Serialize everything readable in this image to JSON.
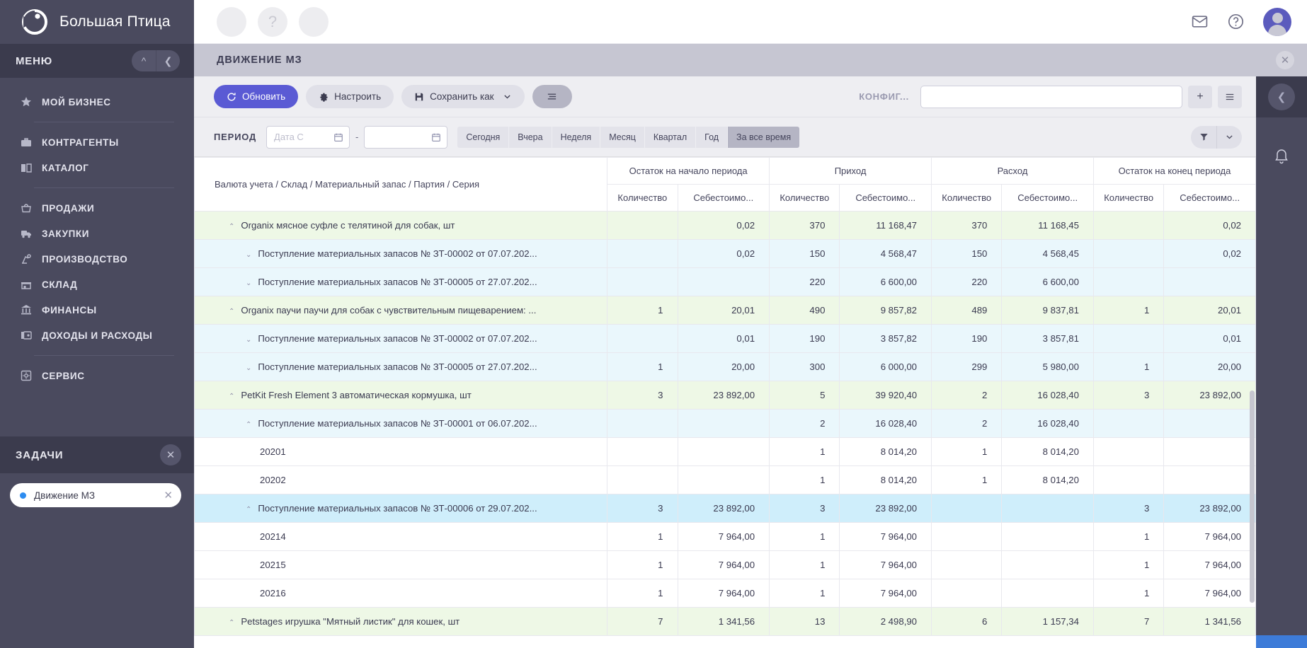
{
  "brand": {
    "name": "Большая Птица",
    "logo_icon": "bird-logo-icon"
  },
  "sidebar": {
    "menu_title": "МЕНЮ",
    "collapse_up_icon": "chevron-up-icon",
    "collapse_left_icon": "chevron-left-icon",
    "items": [
      {
        "label": "МОЙ БИЗНЕС",
        "icon": "star-icon",
        "sep_after": true
      },
      {
        "label": "КОНТРАГЕНТЫ",
        "icon": "briefcase-icon",
        "sep_after": false
      },
      {
        "label": "КАТАЛОГ",
        "icon": "book-icon",
        "sep_after": true
      },
      {
        "label": "ПРОДАЖИ",
        "icon": "basket-icon",
        "sep_after": false
      },
      {
        "label": "ЗАКУПКИ",
        "icon": "truck-icon",
        "sep_after": false
      },
      {
        "label": "ПРОИЗВОДСТВО",
        "icon": "robot-arm-icon",
        "sep_after": false
      },
      {
        "label": "СКЛАД",
        "icon": "warehouse-icon",
        "sep_after": false
      },
      {
        "label": "ФИНАНСЫ",
        "icon": "bank-icon",
        "sep_after": false
      },
      {
        "label": "ДОХОДЫ И РАСХОДЫ",
        "icon": "wallet-icon",
        "sep_after": true
      },
      {
        "label": "СЕРВИС",
        "icon": "service-gear-icon",
        "sep_after": false
      }
    ],
    "tasks": {
      "title": "ЗАДАЧИ",
      "close_icon": "close-icon",
      "items": [
        {
          "label": "Движение МЗ",
          "dot_color": "#2d8cf0",
          "close_icon": "close-icon"
        }
      ]
    }
  },
  "topbar": {
    "circles": [
      {
        "name": "placeholder-circle-1",
        "glyph": ""
      },
      {
        "name": "help-circle",
        "glyph": "?"
      },
      {
        "name": "placeholder-circle-3",
        "glyph": ""
      }
    ],
    "mail_icon": "mail-icon",
    "help_icon": "question-circle-icon",
    "avatar_icon": "user-avatar"
  },
  "page_header": {
    "title": "ДВИЖЕНИЕ МЗ",
    "close_icon": "close-icon"
  },
  "toolbar": {
    "refresh_label": "Обновить",
    "refresh_icon": "refresh-icon",
    "configure_label": "Настроить",
    "configure_icon": "gear-icon",
    "save_as_label": "Сохранить как",
    "save_icon": "floppy-disk-icon",
    "save_caret_icon": "chevron-down-icon",
    "menu_icon": "hamburger-icon",
    "config_label": "КОНФИГ...",
    "config_value": "",
    "config_placeholder": "",
    "add_icon": "plus-icon",
    "list_icon": "list-icon",
    "accent_color": "#5a5ad4"
  },
  "period": {
    "label": "ПЕРИОД",
    "date_from_value": "",
    "date_from_placeholder": "Дата С",
    "date_to_value": "",
    "date_to_placeholder": "",
    "dash": "-",
    "calendar_icon": "calendar-icon",
    "presets": [
      {
        "label": "Сегодня",
        "active": false
      },
      {
        "label": "Вчера",
        "active": false
      },
      {
        "label": "Неделя",
        "active": false
      },
      {
        "label": "Месяц",
        "active": false
      },
      {
        "label": "Квартал",
        "active": false
      },
      {
        "label": "Год",
        "active": false
      },
      {
        "label": "За все время",
        "active": true
      }
    ],
    "filter_icon": "funnel-icon",
    "filter_caret_icon": "chevron-down-icon"
  },
  "table": {
    "name_column_header": "Валюта учета / Склад / Материальный запас / Партия / Серия",
    "groups": [
      {
        "label": "Остаток на начало периода",
        "subs": [
          "Количество",
          "Себестоимо..."
        ]
      },
      {
        "label": "Приход",
        "subs": [
          "Количество",
          "Себестоимо..."
        ]
      },
      {
        "label": "Расход",
        "subs": [
          "Количество",
          "Себестоимо..."
        ]
      },
      {
        "label": "Остаток на конец периода",
        "subs": [
          "Количество",
          "Себестоимо..."
        ]
      }
    ],
    "rows": [
      {
        "level": 0,
        "caret": "up",
        "name": "Organix мясное суфле с телятиной для собак, шт",
        "cells": [
          "",
          "0,02",
          "370",
          "11 168,47",
          "370",
          "11 168,45",
          "",
          "0,02"
        ],
        "selected": false
      },
      {
        "level": 1,
        "caret": "down",
        "name": "Поступление материальных запасов № ЗТ-00002 от 07.07.202...",
        "cells": [
          "",
          "0,02",
          "150",
          "4 568,47",
          "150",
          "4 568,45",
          "",
          "0,02"
        ],
        "selected": false
      },
      {
        "level": 1,
        "caret": "down",
        "name": "Поступление материальных запасов № ЗТ-00005 от 27.07.202...",
        "cells": [
          "",
          "",
          "220",
          "6 600,00",
          "220",
          "6 600,00",
          "",
          ""
        ],
        "selected": false
      },
      {
        "level": 0,
        "caret": "up",
        "name": "Organix паучи паучи для собак с чувствительным пищеварением: ...",
        "cells": [
          "1",
          "20,01",
          "490",
          "9 857,82",
          "489",
          "9 837,81",
          "1",
          "20,01"
        ],
        "selected": false
      },
      {
        "level": 1,
        "caret": "down",
        "name": "Поступление материальных запасов № ЗТ-00002 от 07.07.202...",
        "cells": [
          "",
          "0,01",
          "190",
          "3 857,82",
          "190",
          "3 857,81",
          "",
          "0,01"
        ],
        "selected": false
      },
      {
        "level": 1,
        "caret": "down",
        "name": "Поступление материальных запасов № ЗТ-00005 от 27.07.202...",
        "cells": [
          "1",
          "20,00",
          "300",
          "6 000,00",
          "299",
          "5 980,00",
          "1",
          "20,00"
        ],
        "selected": false
      },
      {
        "level": 0,
        "caret": "up",
        "name": "PetKit Fresh Element 3 автоматическая кормушка, шт",
        "cells": [
          "3",
          "23 892,00",
          "5",
          "39 920,40",
          "2",
          "16 028,40",
          "3",
          "23 892,00"
        ],
        "selected": false
      },
      {
        "level": 1,
        "caret": "up",
        "name": "Поступление материальных запасов № ЗТ-00001 от 06.07.202...",
        "cells": [
          "",
          "",
          "2",
          "16 028,40",
          "2",
          "16 028,40",
          "",
          ""
        ],
        "selected": false
      },
      {
        "level": 2,
        "caret": "none",
        "name": "20201",
        "cells": [
          "",
          "",
          "1",
          "8 014,20",
          "1",
          "8 014,20",
          "",
          ""
        ],
        "selected": false
      },
      {
        "level": 2,
        "caret": "none",
        "name": "20202",
        "cells": [
          "",
          "",
          "1",
          "8 014,20",
          "1",
          "8 014,20",
          "",
          ""
        ],
        "selected": false
      },
      {
        "level": 1,
        "caret": "up",
        "name": "Поступление материальных запасов № ЗТ-00006 от 29.07.202...",
        "cells": [
          "3",
          "23 892,00",
          "3",
          "23 892,00",
          "",
          "",
          "3",
          "23 892,00"
        ],
        "selected": true
      },
      {
        "level": 2,
        "caret": "none",
        "name": "20214",
        "cells": [
          "1",
          "7 964,00",
          "1",
          "7 964,00",
          "",
          "",
          "1",
          "7 964,00"
        ],
        "selected": false
      },
      {
        "level": 2,
        "caret": "none",
        "name": "20215",
        "cells": [
          "1",
          "7 964,00",
          "1",
          "7 964,00",
          "",
          "",
          "1",
          "7 964,00"
        ],
        "selected": false
      },
      {
        "level": 2,
        "caret": "none",
        "name": "20216",
        "cells": [
          "1",
          "7 964,00",
          "1",
          "7 964,00",
          "",
          "",
          "1",
          "7 964,00"
        ],
        "selected": false
      },
      {
        "level": 0,
        "caret": "up",
        "name": "Petstages игрушка \"Мятный листик\" для кошек, шт",
        "cells": [
          "7",
          "1 341,56",
          "13",
          "2 498,90",
          "6",
          "1 157,34",
          "7",
          "1 341,56"
        ],
        "selected": false
      }
    ]
  },
  "rail": {
    "collapse_icon": "chevron-left-icon",
    "bell_icon": "bell-icon"
  }
}
